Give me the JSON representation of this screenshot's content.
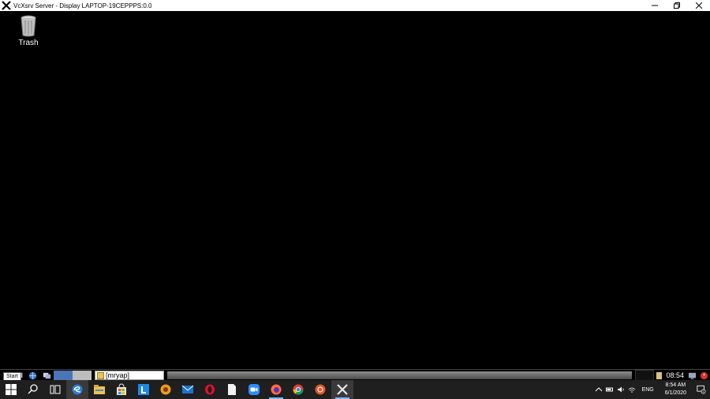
{
  "window": {
    "title": "VcXsrv Server - Display LAPTOP-19CEPPPS:0.0",
    "icon": "vcxsrv-x-icon",
    "controls": [
      "minimize-icon",
      "restore-icon",
      "close-icon"
    ]
  },
  "desktop": {
    "icons": [
      {
        "label": "Trash",
        "icon": "trash-icon"
      }
    ]
  },
  "lxpanel": {
    "start_tooltip": "Start",
    "task_label": "[mryap]",
    "clock": "08:54"
  },
  "taskbar": {
    "apps": [
      "windows-start-icon",
      "search-icon",
      "task-view-icon",
      "edge-icon",
      "file-explorer-icon",
      "store-icon",
      "l-app-icon",
      "app-orange-icon",
      "mail-icon",
      "opera-icon",
      "document-icon",
      "zoom-icon",
      "firefox-icon",
      "chrome-icon",
      "ubuntu-icon",
      "vcxsrv-icon"
    ],
    "tray": {
      "language": "ENG",
      "time": "8:54 AM",
      "date": "6/1/2020",
      "notifications": "1"
    }
  },
  "colors": {
    "desktop_bg": "#000000",
    "taskbar_bg": "#1f1f1f",
    "panel_blue": "#4a76b8",
    "accent_blue": "#7db7ff"
  }
}
